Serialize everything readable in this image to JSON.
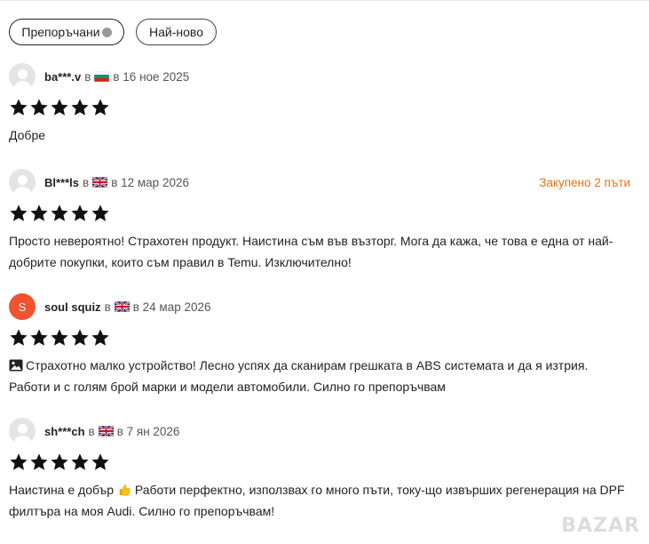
{
  "filters": {
    "recommended_label": "Препоръчани",
    "newest_label": "Най-ново"
  },
  "reviews": [
    {
      "user": "ba***.v",
      "prefix": "в",
      "country": "bg",
      "date": "в 16 ное 2025",
      "badge": "",
      "rating": 5,
      "text": "Добре",
      "has_image_icon": false
    },
    {
      "user": "Bl***ls",
      "prefix": "в",
      "country": "gb",
      "date": "в 12 мар 2026",
      "badge": "Закупено 2 пъти",
      "rating": 5,
      "text": "Просто невероятно! Страхотен продукт. Наистина съм във възторг. Мога да кажа, че това е една от най-добрите покупки, които съм правил в Temu. Изключително!",
      "has_image_icon": false
    },
    {
      "user": "soul squiz",
      "avatar_letter": "S",
      "prefix": "в",
      "country": "gb",
      "date": "в 24 мар 2026",
      "badge": "",
      "rating": 5,
      "text": "Страхотно малко устройство! Лесно успях да сканирам грешката в ABS системата и да я изтрия. Работи и с голям брой марки и модели автомобили. Силно го препоръчвам",
      "has_image_icon": true
    },
    {
      "user": "sh***ch",
      "prefix": "в",
      "country": "gb",
      "date": "в 7 ян 2026",
      "badge": "",
      "rating": 5,
      "text_before_emoji": "Наистина е добър",
      "text_after_emoji": " Работи перфектно, използвах го много пъти, току-що извърших регенерация на DPF филтъра на моя Audi. Силно го препоръчвам!",
      "has_image_icon": false
    }
  ],
  "watermark": "BAZAR",
  "colors": {
    "accent": "#e87317",
    "avatar_orange": "#f0532d",
    "star": "#111111"
  }
}
